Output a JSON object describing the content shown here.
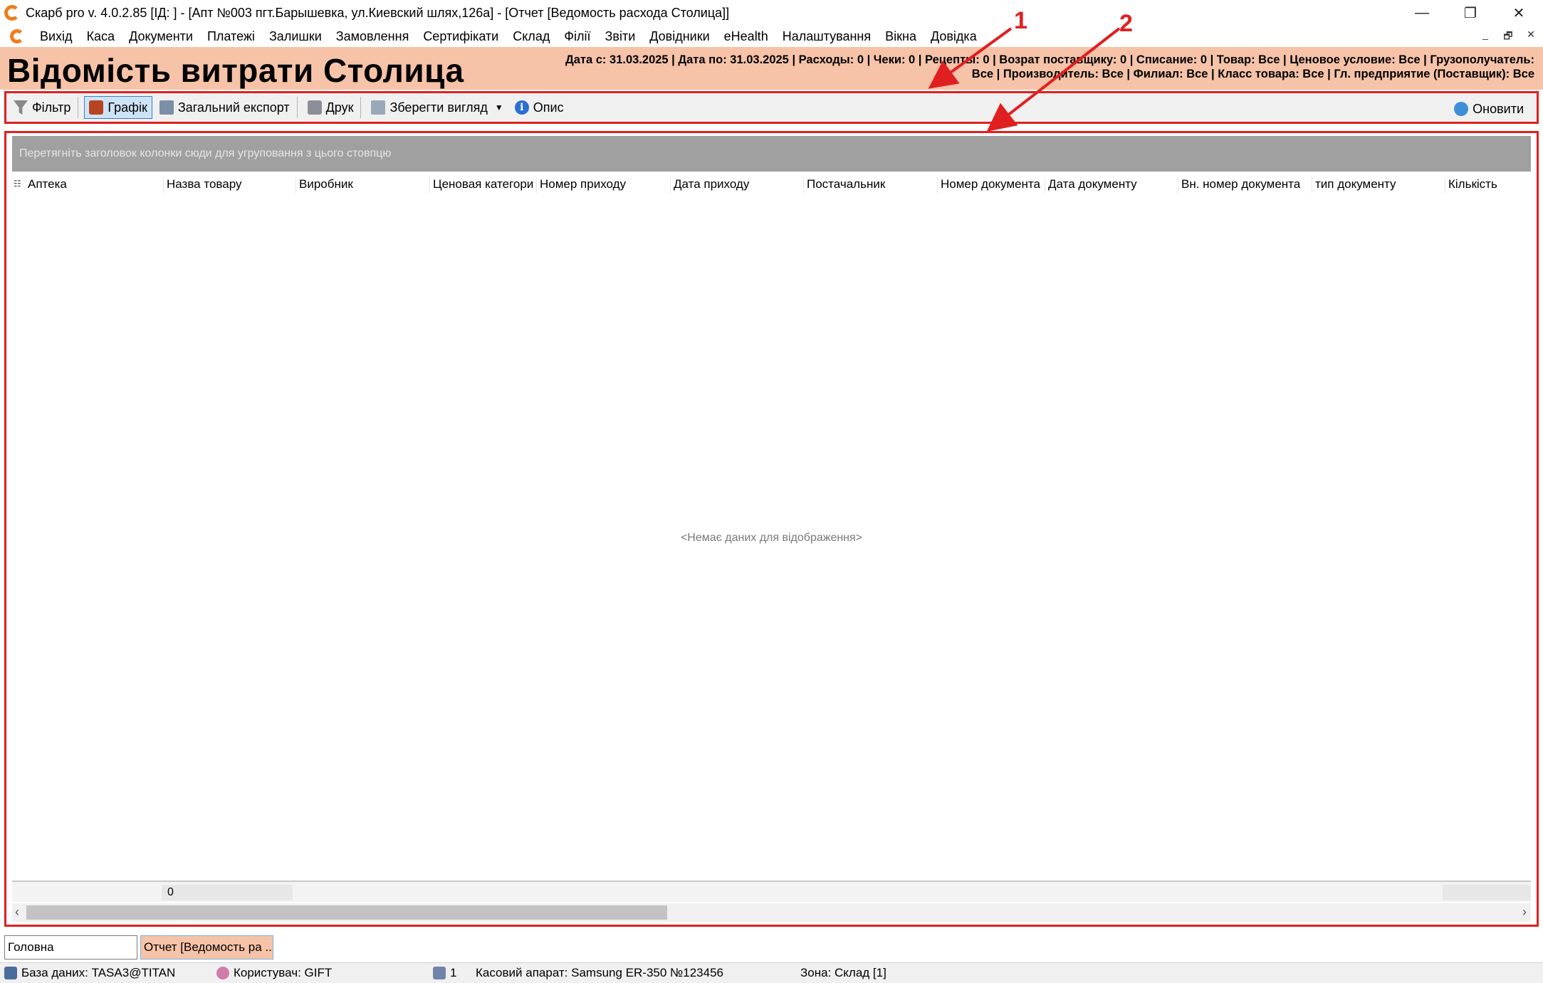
{
  "window": {
    "title": "Скарб pro v. 4.0.2.85 [ІД:       ] - [Апт №003 пгт.Барышевка, ул.Киевский шлях,126а] - [Отчет [Ведомость расхода Столица]]",
    "minimize": "—",
    "restore": "❐",
    "close": "✕"
  },
  "menu": {
    "items": [
      "Вихід",
      "Каса",
      "Документи",
      "Платежі",
      "Залишки",
      "Замовлення",
      "Сертифікати",
      "Склад",
      "Філії",
      "Звіти",
      "Довідники",
      "eHealth",
      "Налаштування",
      "Вікна",
      "Довідка"
    ],
    "mdi_minimize": "_",
    "mdi_restore": "🗗",
    "mdi_close": "✕"
  },
  "header": {
    "title": "Відомість витрати Столица",
    "params_line1": "Дата с: 31.03.2025 | Дата по: 31.03.2025 | Расходы: 0 | Чеки: 0 | Рецепты: 0 | Возрат поставщику: 0 | Списание: 0 | Товар: Все | Ценовое условие: Все | Грузополучатель:",
    "params_line2": "Все | Производитель: Все | Филиал: Все | Класс товара: Все | Гл. предприятие (Поставщик): Все"
  },
  "toolbar": {
    "filter_label": "Фільтр",
    "chart_label": "Графік",
    "export_label": "Загальний експорт",
    "print_label": "Друк",
    "save_view_label": "Зберегти вигляд",
    "info_label": "Опис",
    "refresh_label": "Оновити"
  },
  "grid": {
    "group_panel_text": "Перетягніть заголовок колонки сюди для угруповання з цього стовпцю",
    "columns": [
      "Аптека",
      "Назва товару",
      "Виробник",
      "Ценовая категори",
      "Номер приходу",
      "Дата приходу",
      "Постачальник",
      "Номер документа",
      "Дата документу",
      "Вн. номер документа",
      "тип документу",
      "Кількість"
    ],
    "empty_text": "<Немає даних для відображення>",
    "footer_count": "0"
  },
  "tabs": [
    "Головна",
    "Отчет [Ведомость ра ..."
  ],
  "status": {
    "database": "База даних: TASA3@TITAN",
    "user": "Користувач: GIFT",
    "count": "1",
    "register": "Касовий апарат: Samsung ER-350 №123456",
    "zone": "Зона: Склад [1]"
  },
  "annotations": [
    "1",
    "2"
  ],
  "colors": {
    "header_bg": "#f6c3a8",
    "annotation": "#e02020",
    "group_panel": "#a0a0a0"
  }
}
